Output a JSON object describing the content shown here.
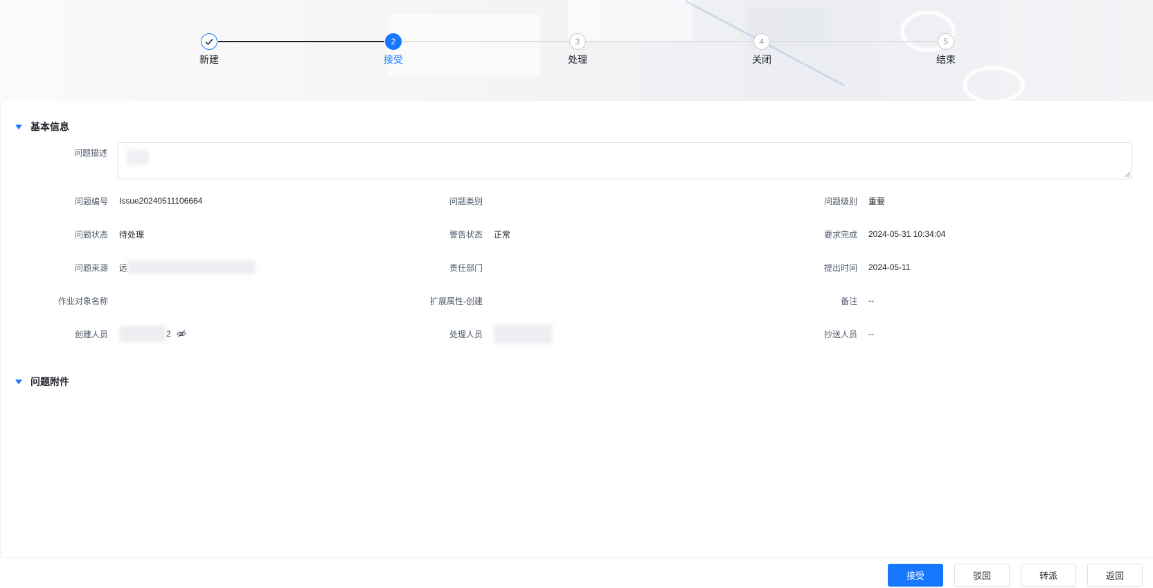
{
  "steps": [
    {
      "num": "1",
      "label": "新建",
      "state": "done"
    },
    {
      "num": "2",
      "label": "接受",
      "state": "active"
    },
    {
      "num": "3",
      "label": "处理",
      "state": "pending"
    },
    {
      "num": "4",
      "label": "关闭",
      "state": "pending"
    },
    {
      "num": "5",
      "label": "结束",
      "state": "pending"
    }
  ],
  "sections": {
    "basic": {
      "title": "基本信息"
    },
    "attachments": {
      "title": "问题附件"
    }
  },
  "description": {
    "label": "问题描述"
  },
  "fields": {
    "issue_no": {
      "label": "问题编号",
      "value": "Issue20240511106664"
    },
    "issue_category": {
      "label": "问题类别",
      "value": ""
    },
    "issue_level": {
      "label": "问题级别",
      "value": "重要"
    },
    "issue_status": {
      "label": "问题状态",
      "value": "待处理"
    },
    "alert_status": {
      "label": "警告状态",
      "value": "正常"
    },
    "required_completion": {
      "label": "要求完成",
      "value": "2024-05-31 10:34:04"
    },
    "issue_source": {
      "label": "问题来源",
      "value": "远"
    },
    "responsible_dept": {
      "label": "责任部门",
      "value": ""
    },
    "submit_time": {
      "label": "提出时间",
      "value": "2024-05-11"
    },
    "work_object_name": {
      "label": "作业对象名称",
      "value": ""
    },
    "ext_attr_create": {
      "label": "扩展属性-创建",
      "value": ""
    },
    "remark": {
      "label": "备注",
      "value": "--"
    },
    "creator": {
      "label": "创建人员",
      "value": "2"
    },
    "handler": {
      "label": "处理人员",
      "value": ""
    },
    "cc": {
      "label": "抄送人员",
      "value": "--"
    }
  },
  "buttons": {
    "accept": "接受",
    "reject": "驳回",
    "transfer": "转派",
    "back": "返回"
  },
  "colors": {
    "accent": "#1677ff",
    "text": "#1f2329",
    "label": "#4e5969"
  }
}
